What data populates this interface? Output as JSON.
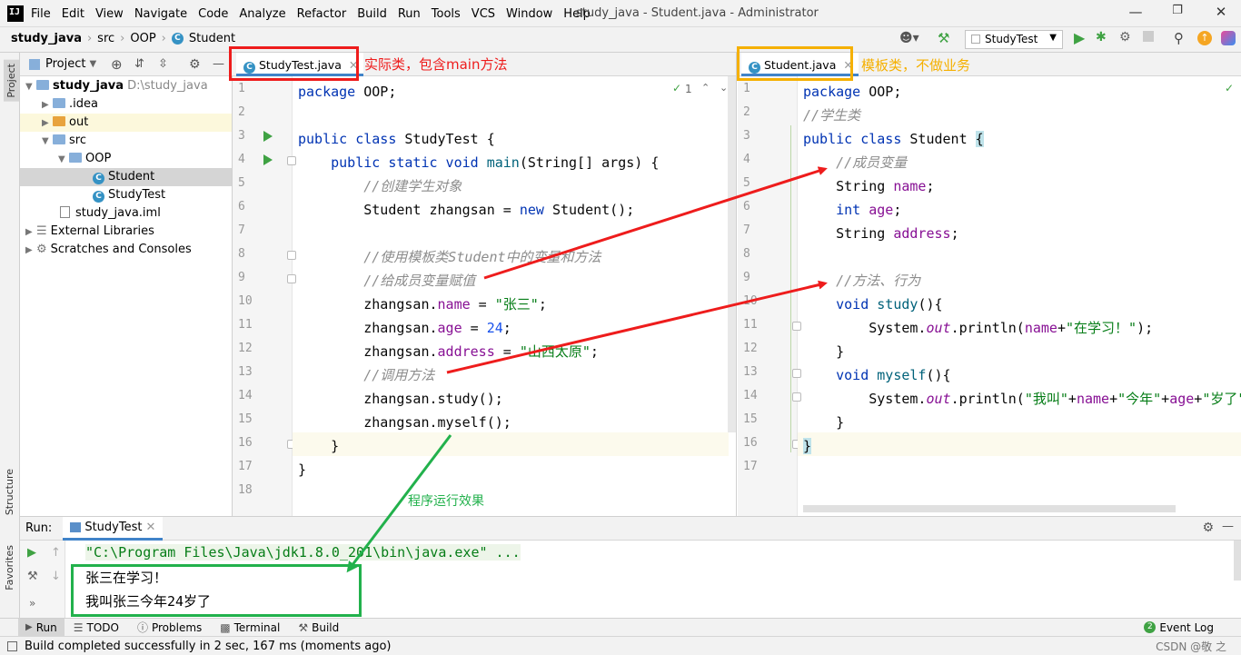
{
  "app": {
    "menu": [
      "File",
      "Edit",
      "View",
      "Navigate",
      "Code",
      "Analyze",
      "Refactor",
      "Build",
      "Run",
      "Tools",
      "VCS",
      "Window",
      "Help"
    ],
    "window_title": "study_java - Student.java - Administrator",
    "logo": "IJ"
  },
  "nav": {
    "crumbs": [
      "study_java",
      "src",
      "OOP",
      "Student"
    ],
    "run_config": "StudyTest"
  },
  "project": {
    "header": "Project",
    "tree": [
      {
        "label": "study_java",
        "extra": "D:\\study_java",
        "icon": "folder-icon"
      },
      {
        "label": ".idea",
        "icon": "folder-icon"
      },
      {
        "label": "out",
        "icon": "folder-icon"
      },
      {
        "label": "src",
        "icon": "folder-icon"
      },
      {
        "label": "OOP",
        "icon": "folder-icon"
      },
      {
        "label": "Student",
        "icon": "class-icon"
      },
      {
        "label": "StudyTest",
        "icon": "class-icon"
      },
      {
        "label": "study_java.iml",
        "icon": "file-icon"
      },
      {
        "label": "External Libraries",
        "icon": "library-icon"
      },
      {
        "label": "Scratches and Consoles",
        "icon": "scratches-icon"
      }
    ]
  },
  "side_tabs": {
    "project": "Project",
    "structure": "Structure",
    "favorites": "Favorites"
  },
  "editor_left": {
    "tab": "StudyTest.java",
    "inspection_count": "1",
    "line_numbers": [
      "1",
      "2",
      "3",
      "4",
      "5",
      "6",
      "7",
      "8",
      "9",
      "10",
      "11",
      "12",
      "13",
      "14",
      "15",
      "16",
      "17",
      "18"
    ]
  },
  "editor_right": {
    "tab": "Student.java",
    "line_numbers": [
      "1",
      "2",
      "3",
      "4",
      "5",
      "6",
      "7",
      "8",
      "9",
      "10",
      "11",
      "12",
      "13",
      "14",
      "15",
      "16",
      "17"
    ]
  },
  "annotations": {
    "left_tab_note": "实际类，包含main方法",
    "right_tab_note": "模板类，不做业务",
    "run_note": "程序运行效果"
  },
  "run": {
    "label": "Run:",
    "tab": "StudyTest",
    "command": "\"C:\\Program Files\\Java\\jdk1.8.0_201\\bin\\java.exe\" ...",
    "output": [
      "张三在学习！",
      "我叫张三今年24岁了"
    ]
  },
  "toolwindows": {
    "run": "Run",
    "todo": "TODO",
    "problems": "Problems",
    "terminal": "Terminal",
    "build": "Build",
    "event_log": "Event Log",
    "event_count": "2"
  },
  "status": {
    "message": "Build completed successfully in 2 sec, 167 ms (moments ago)",
    "watermark": "CSDN @敬 之"
  },
  "colors": {
    "accent": "#4083c9",
    "red": "#ee1c1c",
    "orange": "#f5b000",
    "green": "#22b14c"
  }
}
